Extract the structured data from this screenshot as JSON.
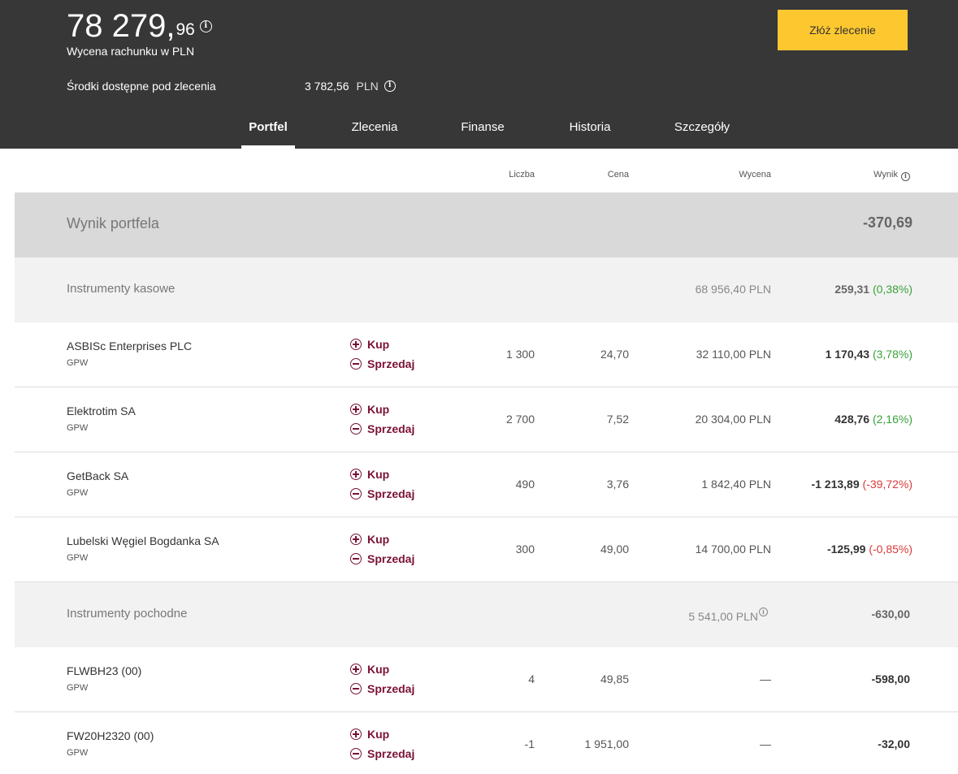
{
  "header": {
    "balance_main": "78 279,",
    "balance_decimal": "96",
    "balance_label": "Wycena rachunku w PLN",
    "funds_label": "Środki dostępne pod zlecenia",
    "funds_value": "3 782,56",
    "funds_currency": "PLN",
    "order_button": "Złóż zlecenie",
    "info_glyph": "i",
    "colors": {
      "background": "#373737",
      "order_button": "#fdc82f"
    }
  },
  "tabs": [
    {
      "label": "Portfel",
      "active": true
    },
    {
      "label": "Zlecenia",
      "active": false
    },
    {
      "label": "Finanse",
      "active": false
    },
    {
      "label": "Historia",
      "active": false
    },
    {
      "label": "Szczegóły",
      "active": false
    }
  ],
  "columns": {
    "quantity": "Liczba",
    "price": "Cena",
    "valuation": "Wycena",
    "result": "Wynik"
  },
  "portfolio_summary": {
    "label": "Wynik portfela",
    "value": "-370,69"
  },
  "groups": [
    {
      "label": "Instrumenty kasowe",
      "valuation": "68 956,40 PLN",
      "result": "259,31",
      "result_pct": "(0,38%)"
    },
    {
      "label": "Instrumenty pochodne",
      "valuation": "5 541,00 PLN",
      "result": "-630,00",
      "result_pct": ""
    }
  ],
  "items": [
    {
      "name": "ASBISc Enterprises PLC",
      "market": "GPW",
      "buy": "Kup",
      "sell": "Sprzedaj",
      "quantity": "1 300",
      "price": "24,70",
      "valuation": "32 110,00 PLN",
      "result": "1 170,43",
      "result_pct": "(3,78%)"
    },
    {
      "name": "Elektrotim SA",
      "market": "GPW",
      "buy": "Kup",
      "sell": "Sprzedaj",
      "quantity": "2 700",
      "price": "7,52",
      "valuation": "20 304,00 PLN",
      "result": "428,76",
      "result_pct": "(2,16%)"
    },
    {
      "name": "GetBack SA",
      "market": "GPW",
      "buy": "Kup",
      "sell": "Sprzedaj",
      "quantity": "490",
      "price": "3,76",
      "valuation": "1 842,40 PLN",
      "result": "-1 213,89",
      "result_pct": "(-39,72%)"
    },
    {
      "name": "Lubelski Węgiel Bogdanka SA",
      "market": "GPW",
      "buy": "Kup",
      "sell": "Sprzedaj",
      "quantity": "300",
      "price": "49,00",
      "valuation": "14 700,00 PLN",
      "result": "-125,99",
      "result_pct": "(-0,85%)"
    },
    {
      "name": "FLWBH23 (00)",
      "market": "GPW",
      "buy": "Kup",
      "sell": "Sprzedaj",
      "quantity": "4",
      "price": "49,85",
      "valuation": "—",
      "result": "-598,00",
      "result_pct": ""
    },
    {
      "name": "FW20H2320 (00)",
      "market": "GPW",
      "buy": "Kup",
      "sell": "Sprzedaj",
      "quantity": "-1",
      "price": "1 951,00",
      "valuation": "—",
      "result": "-32,00",
      "result_pct": ""
    }
  ]
}
